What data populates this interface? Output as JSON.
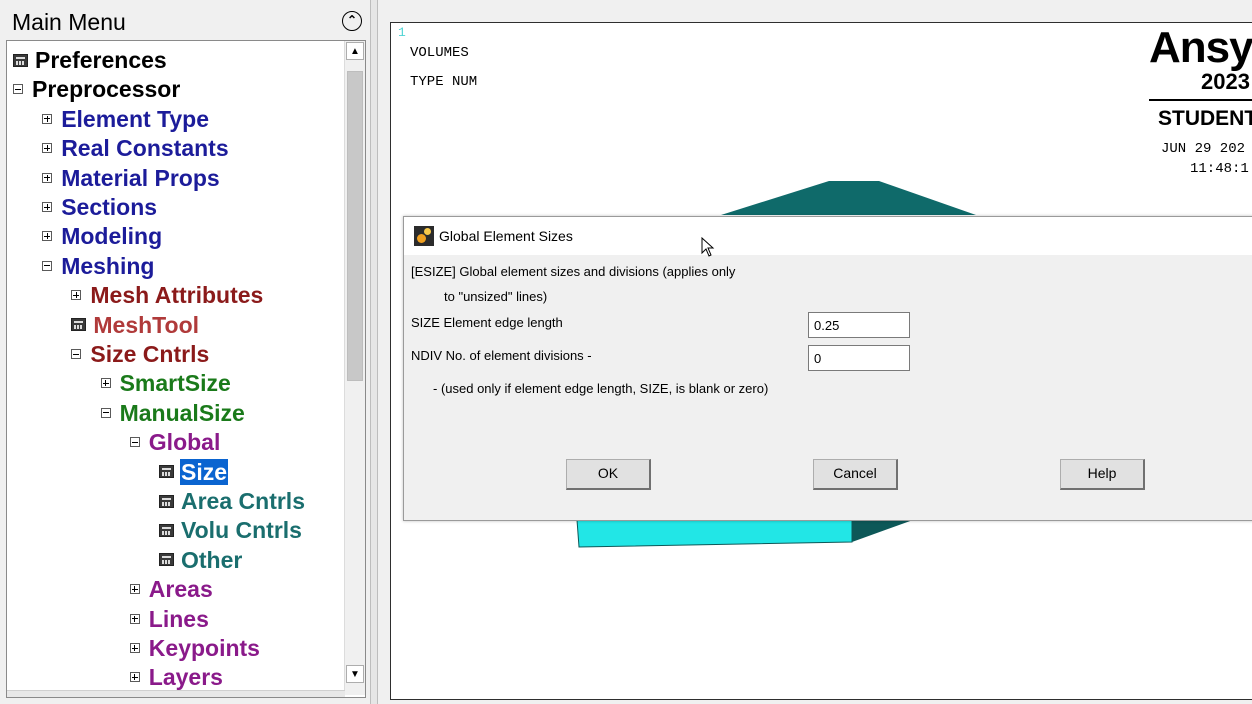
{
  "menu": {
    "title": "Main Menu",
    "tree": [
      {
        "label": "Preferences",
        "indent": 0,
        "type": "leaf",
        "color": "#000000"
      },
      {
        "label": "Preprocessor",
        "indent": 0,
        "type": "minus",
        "color": "#000000"
      },
      {
        "label": "Element Type",
        "indent": 1,
        "type": "plus",
        "color": "#1c1c9a"
      },
      {
        "label": "Real Constants",
        "indent": 1,
        "type": "plus",
        "color": "#1c1c9a"
      },
      {
        "label": "Material Props",
        "indent": 1,
        "type": "plus",
        "color": "#1c1c9a"
      },
      {
        "label": "Sections",
        "indent": 1,
        "type": "plus",
        "color": "#1c1c9a"
      },
      {
        "label": "Modeling",
        "indent": 1,
        "type": "plus",
        "color": "#1c1c9a"
      },
      {
        "label": "Meshing",
        "indent": 1,
        "type": "minus",
        "color": "#1c1c9a"
      },
      {
        "label": "Mesh Attributes",
        "indent": 2,
        "type": "plus",
        "color": "#8b1a1a"
      },
      {
        "label": "MeshTool",
        "indent": 2,
        "type": "leaf",
        "color": "#b03a3a"
      },
      {
        "label": "Size Cntrls",
        "indent": 2,
        "type": "minus",
        "color": "#8b1a1a"
      },
      {
        "label": "SmartSize",
        "indent": 3,
        "type": "plus",
        "color": "#1a7a1a"
      },
      {
        "label": "ManualSize",
        "indent": 3,
        "type": "minus",
        "color": "#1a7a1a"
      },
      {
        "label": "Global",
        "indent": 4,
        "type": "minus",
        "color": "#8a1a8a"
      },
      {
        "label": "Size",
        "indent": 5,
        "type": "leaf",
        "color": "#ffffff",
        "selected": true
      },
      {
        "label": "Area Cntrls",
        "indent": 5,
        "type": "leaf",
        "color": "#1a6e6e"
      },
      {
        "label": "Volu Cntrls",
        "indent": 5,
        "type": "leaf",
        "color": "#1a6e6e"
      },
      {
        "label": "Other",
        "indent": 5,
        "type": "leaf",
        "color": "#1a6e6e"
      },
      {
        "label": "Areas",
        "indent": 4,
        "type": "plus",
        "color": "#8a1a8a"
      },
      {
        "label": "Lines",
        "indent": 4,
        "type": "plus",
        "color": "#8a1a8a"
      },
      {
        "label": "Keypoints",
        "indent": 4,
        "type": "plus",
        "color": "#8a1a8a"
      },
      {
        "label": "Layers",
        "indent": 4,
        "type": "plus",
        "color": "#8a1a8a"
      }
    ]
  },
  "graphics": {
    "window_number": "1",
    "line1": "VOLUMES",
    "line2": "TYPE NUM",
    "logo": "Ansys",
    "year": "2023",
    "edition": "STUDENT",
    "date": "JUN 29 202",
    "time": "11:48:1",
    "colors": {
      "model_top": "#0f6a6a",
      "model_front": "#22e6e6",
      "model_side": "#0d5858"
    }
  },
  "dialog": {
    "title": "Global Element Sizes",
    "desc_line1": "[ESIZE]  Global element sizes and divisions (applies only",
    "desc_line2": "to \"unsized\" lines)",
    "size_label": "SIZE  Element edge length",
    "size_value": "0.25",
    "ndiv_label": "NDIV  No. of element divisions -",
    "ndiv_value": "0",
    "note": "- (used only if element edge length, SIZE, is blank or zero)",
    "ok_label": "OK",
    "cancel_label": "Cancel",
    "help_label": "Help"
  }
}
